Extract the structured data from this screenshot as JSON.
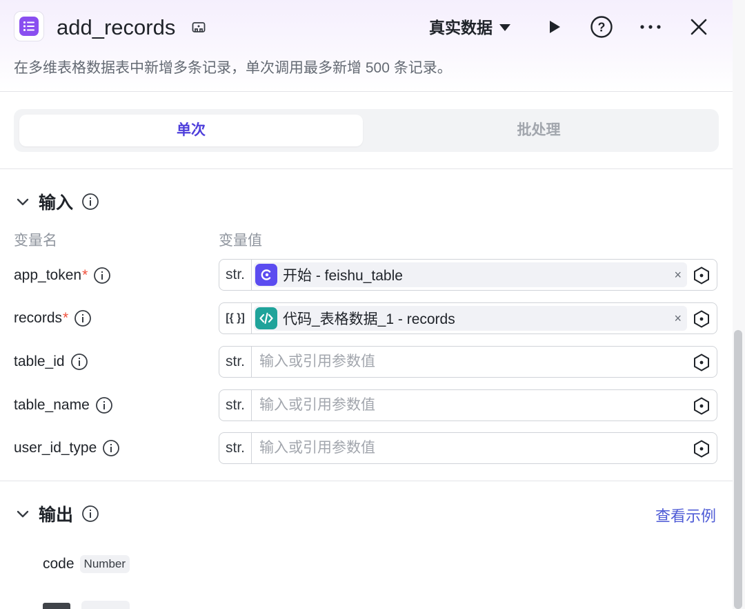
{
  "header": {
    "title": "add_records",
    "dataset_label": "真实数据",
    "description": "在多维表格数据表中新增多条记录，单次调用最多新增 500 条记录。"
  },
  "tabs": [
    {
      "label": "单次",
      "active": true
    },
    {
      "label": "批处理",
      "active": false
    }
  ],
  "input_section": {
    "title": "输入",
    "col_name": "变量名",
    "col_value": "变量值",
    "params": [
      {
        "name": "app_token",
        "required": true,
        "type": "str.",
        "mode": "reference",
        "ref_text": "开始 - feishu_table",
        "ref_icon": "start-node-icon",
        "ref_color": "#5b4cf0",
        "clear": "×"
      },
      {
        "name": "records",
        "required": true,
        "type": "[{ }]",
        "mode": "reference",
        "ref_text": "代码_表格数据_1 - records",
        "ref_icon": "code-node-icon",
        "ref_color": "#1fa39a",
        "clear": "×"
      },
      {
        "name": "table_id",
        "required": false,
        "type": "str.",
        "mode": "empty",
        "placeholder": "输入或引用参数值"
      },
      {
        "name": "table_name",
        "required": false,
        "type": "str.",
        "mode": "empty",
        "placeholder": "输入或引用参数值"
      },
      {
        "name": "user_id_type",
        "required": false,
        "type": "str.",
        "mode": "empty",
        "placeholder": "输入或引用参数值"
      }
    ],
    "required_mark": "*"
  },
  "output_section": {
    "title": "输出",
    "example_link": "查看示例",
    "fields": [
      {
        "name": "code",
        "type": "Number"
      }
    ]
  },
  "colors": {
    "accent": "#4e3fdb",
    "app_icon": "#8a4ff0",
    "link": "#4e5bd6",
    "required": "#f0503c"
  }
}
